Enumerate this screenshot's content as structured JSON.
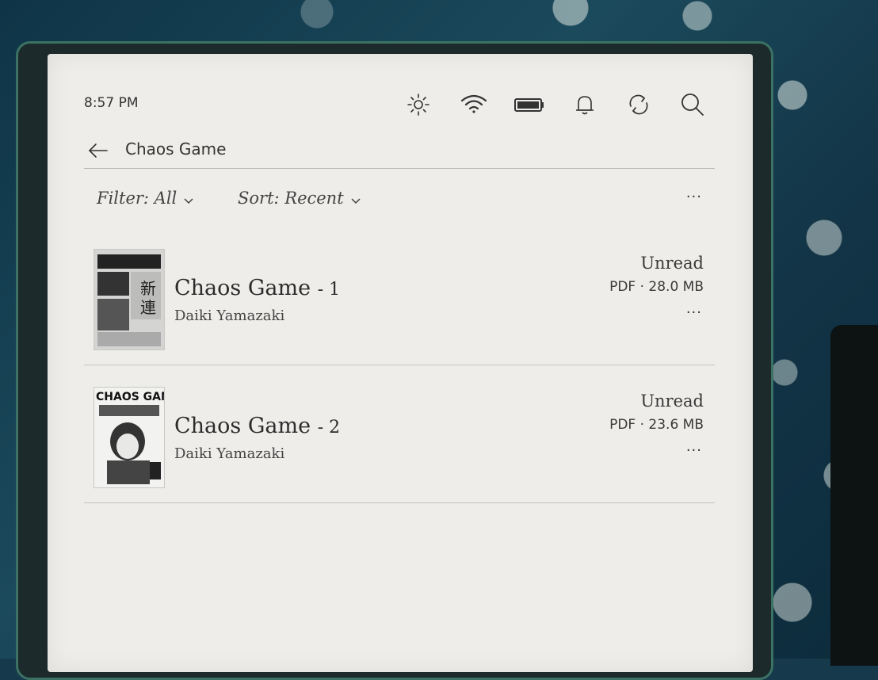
{
  "status_bar": {
    "time": "8:57 PM",
    "icons": [
      "brightness-icon",
      "wifi-icon",
      "battery-icon",
      "notification-bell-icon",
      "sync-icon",
      "search-icon"
    ]
  },
  "nav": {
    "back_icon": "back-arrow-icon",
    "title": "Chaos Game"
  },
  "filters": {
    "filter_label": "Filter: All",
    "sort_label": "Sort: Recent",
    "more_label": "···"
  },
  "books": [
    {
      "title": "Chaos Game",
      "volume": "- 1",
      "author": "Daiki Yamazaki",
      "status": "Unread",
      "meta": "PDF · 28.0 MB",
      "more_label": "···"
    },
    {
      "title": "Chaos Game",
      "volume": "- 2",
      "author": "Daiki Yamazaki",
      "status": "Unread",
      "meta": "PDF · 23.6 MB",
      "more_label": "···",
      "cover_text": "CHAOS GAME"
    }
  ],
  "colors": {
    "screen": "#eeedea",
    "text": "#2a2a2a",
    "divider": "#c4c3bf",
    "case": "#163a4c"
  }
}
